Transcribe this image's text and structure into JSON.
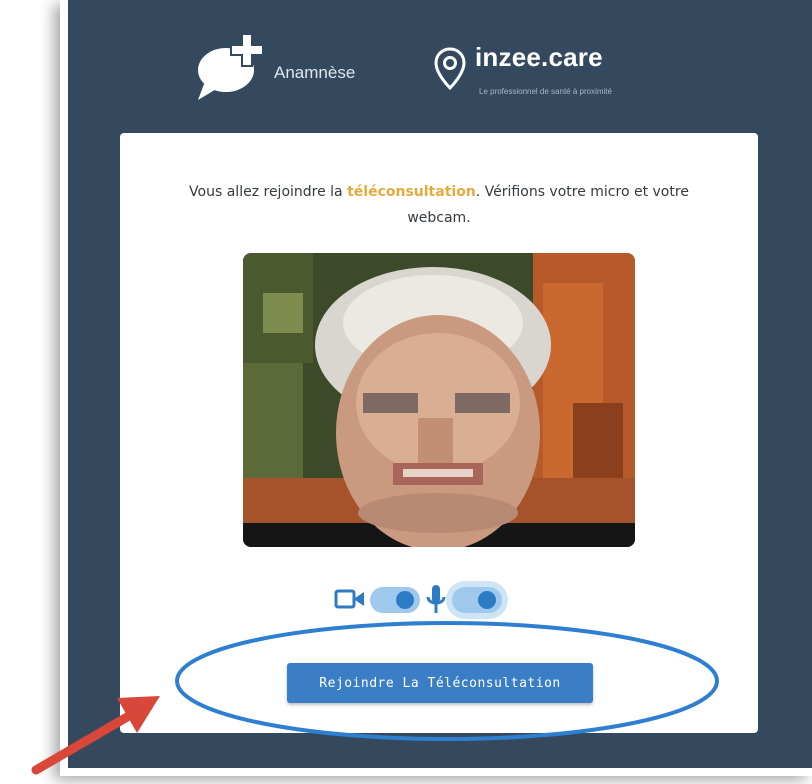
{
  "header": {
    "app_name": "Anamnèse",
    "brand_name": "inzee.care",
    "brand_tagline": "Le professionnel de santé à proximité"
  },
  "card": {
    "intro_part1": "Vous allez rejoindre la ",
    "intro_highlight": "téléconsultation",
    "intro_part2": ". Vérifions votre micro et votre webcam.",
    "camera_toggle_on": true,
    "microphone_toggle_on": true,
    "join_button_label": "Rejoindre La Téléconsultation"
  },
  "colors": {
    "background": "#34495e",
    "accent": "#3a7fc5",
    "highlight": "#e8a93c",
    "annotation_ellipse": "#2f7fd1",
    "annotation_arrow": "#d9463a"
  }
}
